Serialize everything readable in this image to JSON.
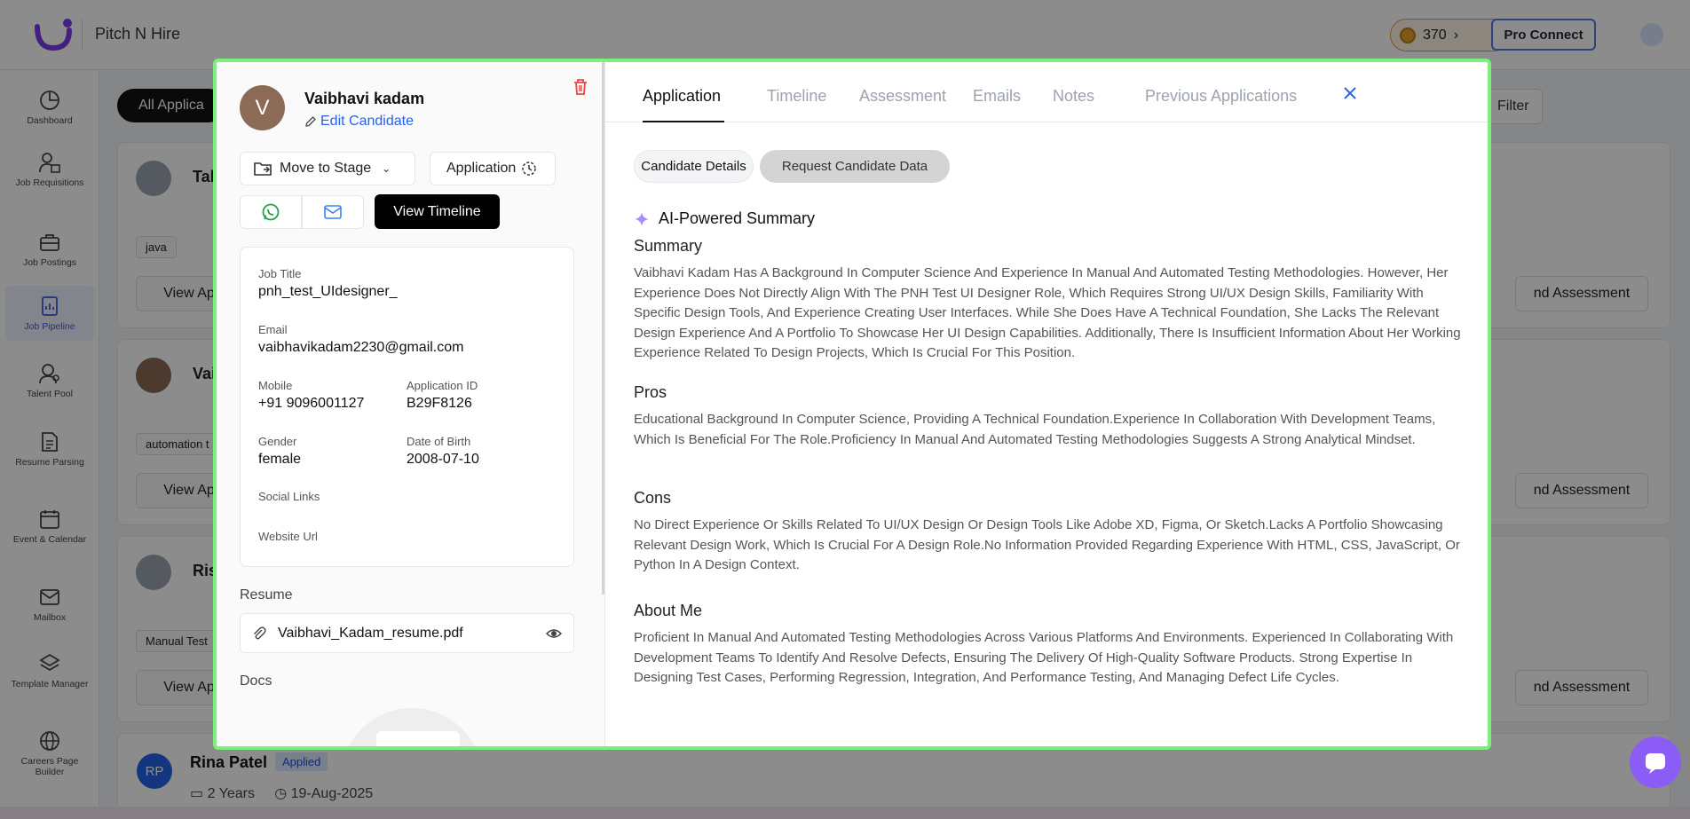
{
  "app": {
    "title": "Pitch N Hire",
    "coins": "370",
    "pro_connect": "Pro Connect"
  },
  "sidebar": {
    "items": [
      {
        "label": "Dashboard",
        "icon": "dashboard-icon"
      },
      {
        "label": "Job Requisitions",
        "icon": "job-requisitions-icon"
      },
      {
        "label": "Job Postings",
        "icon": "briefcase-icon"
      },
      {
        "label": "Job Pipeline",
        "icon": "pipeline-icon",
        "active": true
      },
      {
        "label": "Talent Pool",
        "icon": "talent-pool-icon"
      },
      {
        "label": "Resume Parsing",
        "icon": "resume-icon"
      },
      {
        "label": "Event & Calendar",
        "icon": "calendar-icon"
      },
      {
        "label": "Mailbox",
        "icon": "mail-icon"
      },
      {
        "label": "Template Manager",
        "icon": "layers-icon"
      },
      {
        "label": "Careers Page Builder",
        "icon": "globe-icon"
      }
    ]
  },
  "background": {
    "tab_label": "All Applica",
    "filter_label": "Filter",
    "cards": [
      {
        "name_fragment": "Tal",
        "chip": "java",
        "view_btn": "View Ap",
        "assess_btn": "nd Assessment"
      },
      {
        "name_fragment": "Vai",
        "chip": "automation t",
        "view_btn": "View Ap",
        "assess_btn": "nd Assessment"
      },
      {
        "name_fragment": "Ris",
        "chip": "Manual Test",
        "view_btn": "View Ap",
        "assess_btn": "nd Assessment"
      }
    ],
    "rina": {
      "initials": "RP",
      "name": "Rina Patel",
      "badge": "Applied",
      "experience": "2 Years",
      "date": "19-Aug-2025"
    }
  },
  "candidate": {
    "initial": "V",
    "name": "Vaibhavi kadam",
    "edit_label": "Edit Candidate",
    "move_to_stage": "Move to Stage",
    "application_btn": "Application",
    "view_timeline": "View Timeline",
    "details": {
      "job_title_label": "Job Title",
      "job_title": "pnh_test_UIdesigner_",
      "email_label": "Email",
      "email": "vaibhavikadam2230@gmail.com",
      "mobile_label": "Mobile",
      "mobile": "+91 9096001127",
      "app_id_label": "Application ID",
      "app_id": "B29F8126",
      "gender_label": "Gender",
      "gender": "female",
      "dob_label": "Date of Birth",
      "dob": "2008-07-10",
      "social_label": "Social Links",
      "website_label": "Website Url"
    },
    "resume_label": "Resume",
    "resume_file": "Vaibhavi_Kadam_resume.pdf",
    "docs_label": "Docs"
  },
  "tabs": [
    "Application",
    "Timeline",
    "Assessment",
    "Emails",
    "Notes",
    "Previous Applications"
  ],
  "pills": {
    "details": "Candidate Details",
    "request": "Request Candidate Data"
  },
  "summary": {
    "ai_title": "AI-Powered Summary",
    "summary_title": "Summary",
    "summary_text": "Vaibhavi Kadam Has A Background In Computer Science And Experience In Manual And Automated Testing Methodologies. However, Her Experience Does Not Directly Align With The PNH Test UI Designer Role, Which Requires Strong UI/UX Design Skills, Familiarity With Specific Design Tools, And Experience Creating User Interfaces. While She Does Have A Technical Foundation, She Lacks The Relevant Design Experience And A Portfolio To Showcase Her UI Design Capabilities. Additionally, There Is Insufficient Information About Her Working Experience Related To Design Projects, Which Is Crucial For This Position.",
    "pros_title": "Pros",
    "pros_text": "Educational Background In Computer Science, Providing A Technical Foundation.Experience In Collaboration With Development Teams, Which Is Beneficial For The Role.Proficiency In Manual And Automated Testing Methodologies Suggests A Strong Analytical Mindset.",
    "cons_title": "Cons",
    "cons_text": "No Direct Experience Or Skills Related To UI/UX Design Or Design Tools Like Adobe XD, Figma, Or Sketch.Lacks A Portfolio Showcasing Relevant Design Work, Which Is Crucial For A Design Role.No Information Provided Regarding Experience With HTML, CSS, JavaScript, Or Python In A Design Context.",
    "about_title": "About Me",
    "about_text": "Proficient In Manual And Automated Testing Methodologies Across Various Platforms And Environments. Experienced In Collaborating With Development Teams To Identify And Resolve Defects, Ensuring The Delivery Of High-Quality Software Products. Strong Expertise In Designing Test Cases, Performing Regression, Integration, And Performance Testing, And Managing Defect Life Cycles."
  },
  "colors": {
    "accent": "#2563eb",
    "highlight_border": "#7cf07c",
    "coin": "#e5a323"
  }
}
